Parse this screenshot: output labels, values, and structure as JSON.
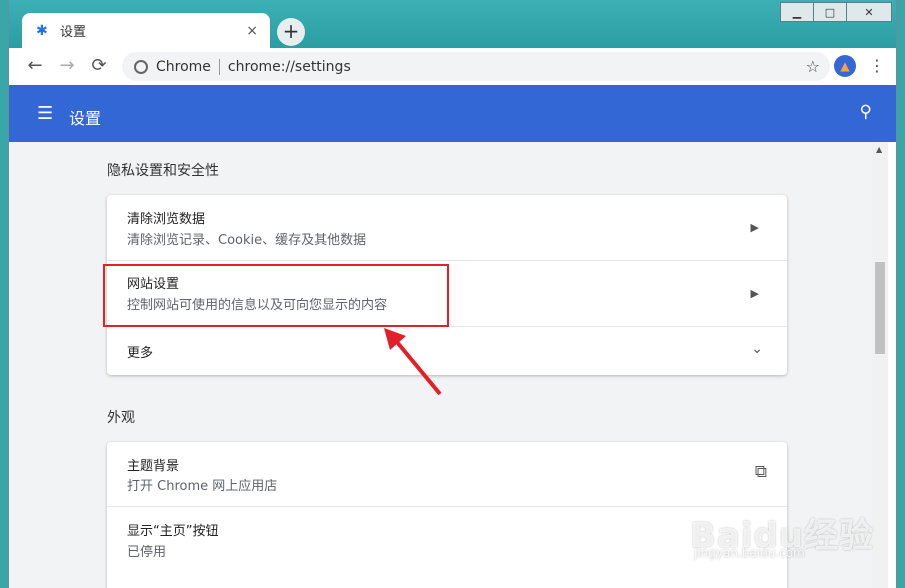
{
  "window": {
    "minimize": "▁",
    "maximize": "□",
    "close": "✕"
  },
  "tab": {
    "title": "设置",
    "close": "×",
    "icon": "gear-icon"
  },
  "newtab": "+",
  "toolbar": {
    "back": "←",
    "forward": "→",
    "reload": "⟳",
    "site": "Chrome",
    "url": "chrome://settings",
    "star": "☆",
    "menu": "⋮"
  },
  "appbar": {
    "menu": "☰",
    "title": "设置",
    "search": "🔍"
  },
  "privacy": {
    "heading": "隐私设置和安全性",
    "items": [
      {
        "title": "清除浏览数据",
        "subtitle": "清除浏览记录、Cookie、缓存及其他数据"
      },
      {
        "title": "网站设置",
        "subtitle": "控制网站可使用的信息以及可向您显示的内容"
      },
      {
        "title": "更多"
      }
    ]
  },
  "appearance": {
    "heading": "外观",
    "items": [
      {
        "title": "主题背景",
        "subtitle": "打开 Chrome 网上应用店"
      },
      {
        "title": "显示“主页”按钮",
        "subtitle": "已停用"
      }
    ]
  },
  "watermark": {
    "logo": "Baidu经验",
    "url": "jingyan.baidu.com"
  },
  "colors": {
    "accent": "#3367d6",
    "highlight": "#e3202a"
  }
}
